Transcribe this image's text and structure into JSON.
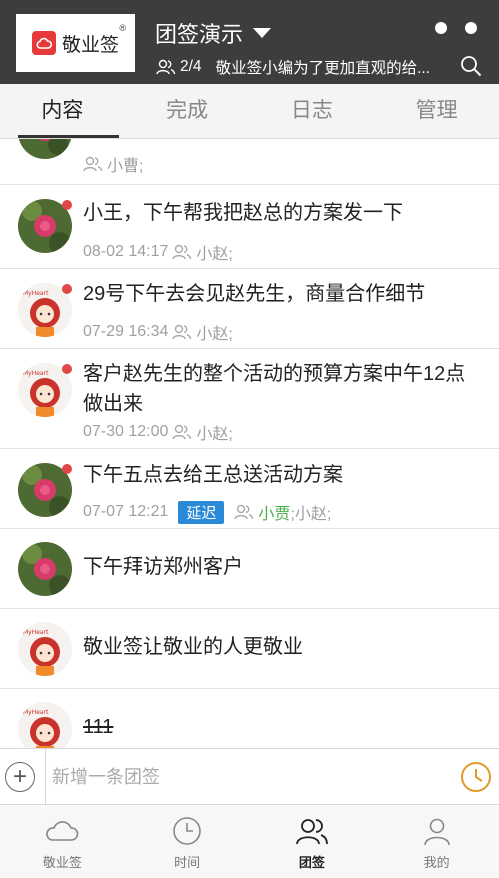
{
  "header": {
    "logo_text": "敬业签",
    "logo_reg": "®",
    "group_title": "团签演示",
    "member_count": "2/4",
    "subtitle": "敬业签小编为了更加直观的给..."
  },
  "tabs": [
    {
      "label": "内容",
      "active": true
    },
    {
      "label": "完成",
      "active": false
    },
    {
      "label": "日志",
      "active": false
    },
    {
      "label": "管理",
      "active": false
    }
  ],
  "items": [
    {
      "avatar": "flower",
      "title": "",
      "date": "",
      "badge": "",
      "assignees": "小曹;",
      "highlight": "",
      "unread": false,
      "strike": false
    },
    {
      "avatar": "flower",
      "title": "小王，下午帮我把赵总的方案发一下",
      "date": "08-02 14:17",
      "badge": "",
      "assignees": "小赵;",
      "highlight": "",
      "unread": true,
      "strike": false
    },
    {
      "avatar": "girl",
      "title": "29号下午去会见赵先生，商量合作细节",
      "date": "07-29 16:34",
      "badge": "",
      "assignees": "小赵;",
      "highlight": "",
      "unread": true,
      "strike": false
    },
    {
      "avatar": "girl",
      "title": "客户赵先生的整个活动的预算方案中午12点做出来",
      "date": "07-30 12:00",
      "badge": "",
      "assignees": "小赵;",
      "highlight": "",
      "unread": true,
      "strike": false
    },
    {
      "avatar": "flower",
      "title": "下午五点去给王总送活动方案",
      "date": "07-07 12:21",
      "badge": "延迟",
      "assignees": ";小赵;",
      "highlight": "小贾",
      "unread": true,
      "strike": false
    },
    {
      "avatar": "flower",
      "title": "下午拜访郑州客户",
      "date": "",
      "badge": "",
      "assignees": "",
      "highlight": "",
      "unread": false,
      "strike": false
    },
    {
      "avatar": "girl",
      "title": "敬业签让敬业的人更敬业",
      "date": "",
      "badge": "",
      "assignees": "",
      "highlight": "",
      "unread": false,
      "strike": false
    },
    {
      "avatar": "girl",
      "title": "111",
      "date": "",
      "badge": "",
      "assignees": "",
      "highlight": "",
      "unread": false,
      "strike": true
    }
  ],
  "input": {
    "placeholder": "新增一条团签",
    "value": ""
  },
  "bottom_nav": [
    {
      "label": "敬业签",
      "icon": "cloud-icon",
      "active": false
    },
    {
      "label": "时间",
      "icon": "clock-icon",
      "active": false
    },
    {
      "label": "团签",
      "icon": "group-icon",
      "active": true
    },
    {
      "label": "我的",
      "icon": "person-icon",
      "active": false
    }
  ],
  "colors": {
    "header_bg": "#3d3d3d",
    "unread_dot": "#e04848",
    "badge_bg": "#2a8ad8",
    "highlight_name": "#4bb04b",
    "clock_accent": "#e09a2a"
  }
}
